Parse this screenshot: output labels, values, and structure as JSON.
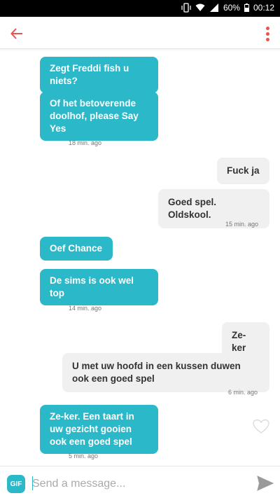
{
  "status": {
    "battery": "60%",
    "time": "00:12"
  },
  "messages": [
    {
      "dir": "in",
      "text": "Zegt Freddi fish u niets?"
    },
    {
      "dir": "in",
      "text": "Of het betoverende doolhof, please Say Yes"
    },
    {
      "ts": "18 min. ago"
    },
    {
      "dir": "out",
      "text": "Fuck ja"
    },
    {
      "dir": "out",
      "text": "Goed spel. Oldskool."
    },
    {
      "ts": "15 min. ago"
    },
    {
      "dir": "in",
      "text": "Oef Chance"
    },
    {
      "dir": "in",
      "text": "De sims is ook wel top"
    },
    {
      "ts": "14 min. ago"
    },
    {
      "dir": "out",
      "text": "Ze-ker"
    },
    {
      "dir": "out",
      "text": "U met uw hoofd in een kussen duwen ook een goed spel"
    },
    {
      "ts": "6 min. ago"
    },
    {
      "dir": "in",
      "text": "Ze-ker. Een taart in uw gezicht gooien ook een goed spel"
    },
    {
      "ts": "5 min. ago"
    }
  ],
  "composer": {
    "gif_label": "GIF",
    "placeholder": "Send a message..."
  },
  "colors": {
    "accent": "#2bb8c8",
    "brand": "#e8544f",
    "outgoing": "#f0f0f0"
  }
}
